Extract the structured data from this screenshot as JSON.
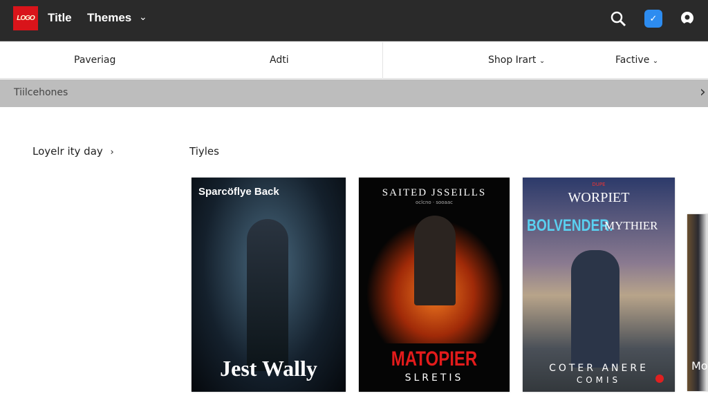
{
  "header": {
    "logo_text": "LOGO",
    "title": "Title",
    "themes": "Themes",
    "icons": [
      "search-icon",
      "app-badge-icon",
      "user-icon"
    ],
    "brand_color": "#d9141a",
    "accent": "#2d8cf0"
  },
  "nav": {
    "items": [
      "Paveriag",
      "Adti",
      "Shop Irart",
      "Factive"
    ]
  },
  "banner": {
    "text": "Tiilcehones"
  },
  "sidebar": {
    "link": "Loyelr ity day"
  },
  "section": {
    "title": "Tiyles"
  },
  "posters": [
    {
      "top": "Sparcöflye Back",
      "bottom": "Jest Wally"
    },
    {
      "top": "SAITED JSSEILLS",
      "sub": "oclcno · sooaac",
      "bottom": "MATOPIER",
      "bottom2": "SLRETIS"
    },
    {
      "badge": "DUPE",
      "top": "WORPIET",
      "mid": "BOLVENDER.",
      "mid2": "MYTHIER",
      "bottom": "COTER ANERE",
      "bottom2": "COMIS"
    },
    {
      "bottom": "Mo"
    }
  ]
}
